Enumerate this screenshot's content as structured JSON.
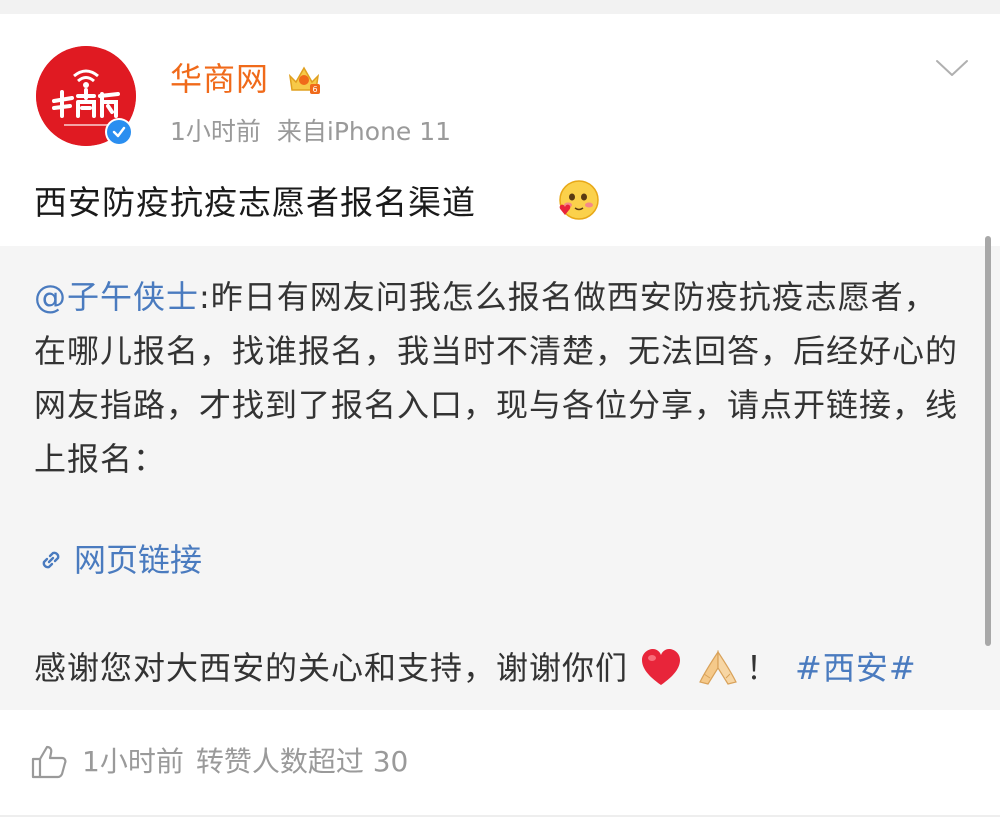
{
  "post": {
    "username": "华商网",
    "time": "1小时前",
    "source": "来自iPhone 11",
    "title": "西安防疫抗疫志愿者报名渠道",
    "title_emoji": "blush-heart-emoji"
  },
  "repost": {
    "mention": "@子午侠士",
    "body": ":昨日有网友问我怎么报名做西安防疫抗疫志愿者，在哪儿报名，找谁报名，我当时不清楚，无法回答，后经好心的网友指路，才找到了报名入口，现与各位分享，请点开链接，线上报名：",
    "link_label": "网页链接",
    "thanks_text": "感谢您对大西安的关心和支持，谢谢你们",
    "exclamation": "！",
    "hashtag": "#西安#"
  },
  "footer": {
    "time": "1小时前",
    "repost_count": "转赞人数超过 30"
  },
  "icons": {
    "avatar": "huashang-logo",
    "verified": "verified-badge-icon",
    "vip": "vip-crown-icon",
    "menu": "chevron-down-icon",
    "link": "link-icon",
    "heart": "red-heart-emoji",
    "hands": "praying-hands-emoji",
    "like": "thumbs-up-icon"
  },
  "colors": {
    "username": "#f06a1a",
    "link": "#4a7bbf",
    "meta": "#9a9a9a",
    "repost_bg": "#f5f5f5",
    "avatar_bg": "#e01a22",
    "verified": "#2a8ef0"
  }
}
